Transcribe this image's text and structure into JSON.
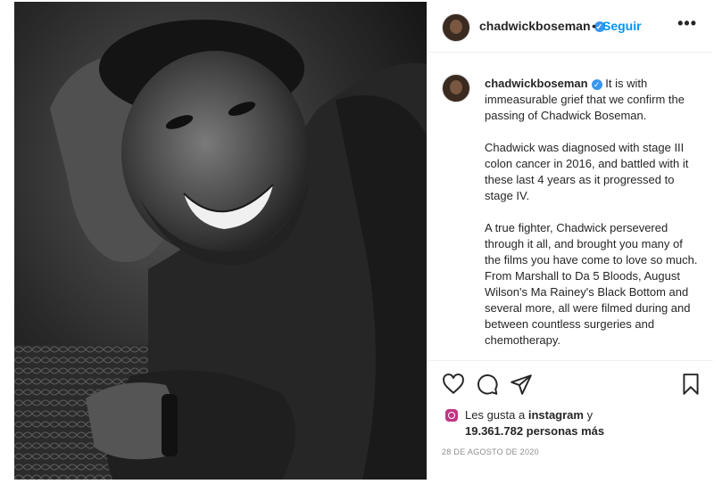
{
  "post": {
    "username": "chadwickboseman",
    "verified_mark": "✓",
    "follow_label": "Seguir",
    "separator": "•",
    "more_label": "•••",
    "caption_username": "chadwickboseman",
    "caption_intro": "It is with immeasurable grief that we confirm the passing of Chadwick Boseman.",
    "caption_p2": "Chadwick was diagnosed with stage III colon cancer in 2016, and battled with it these last 4 years as it progressed to stage IV.",
    "caption_p3": "A true fighter, Chadwick persevered through it all, and brought you many of the films you have come to love so much. From Marshall to Da 5 Bloods, August Wilson's Ma Rainey's Black Bottom and several more, all were filmed during and between countless surgeries and chemotherapy."
  },
  "actions": {
    "like_icon": "heart-icon",
    "comment_icon": "comment-icon",
    "share_icon": "paper-plane-icon",
    "save_icon": "bookmark-icon"
  },
  "likes": {
    "prefix": "Les gusta a",
    "user": "instagram",
    "suffix": "y",
    "count": "19.361.782 personas más"
  },
  "date": "28 DE AGOSTO DE 2020",
  "colors": {
    "link": "#0095f6",
    "verified": "#3897f0",
    "muted": "#8e8e8e",
    "divider": "#efefef"
  }
}
